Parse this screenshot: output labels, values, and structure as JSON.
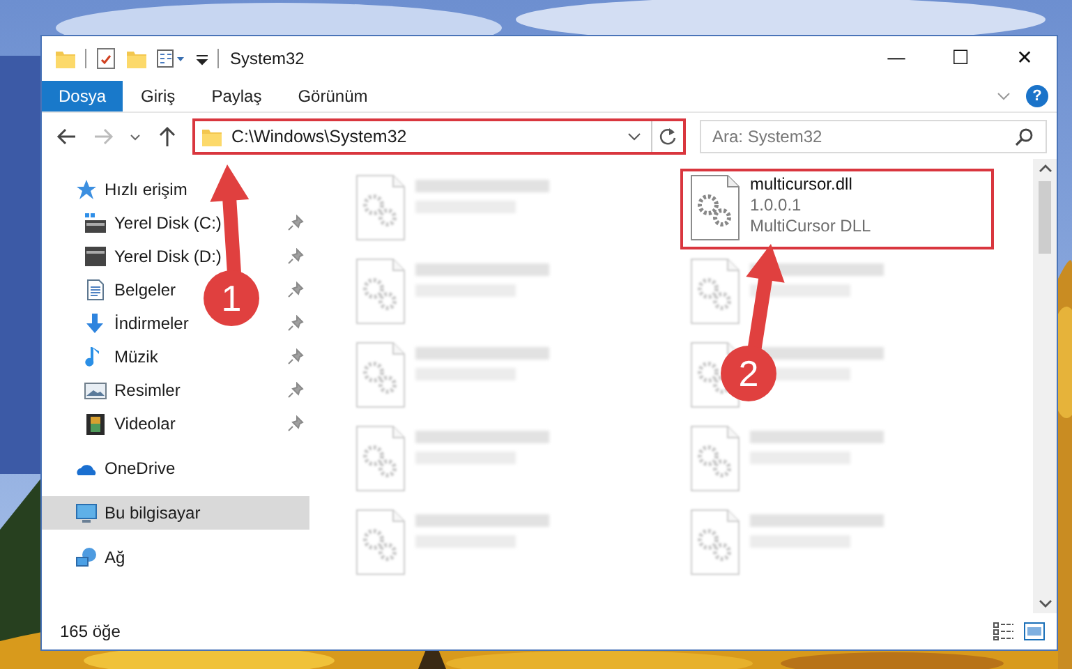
{
  "window": {
    "title": "System32",
    "controls": {
      "minimize": "—",
      "maximize": "☐",
      "close": "✕"
    }
  },
  "ribbon": {
    "tabs": [
      {
        "label": "Dosya",
        "selected": true
      },
      {
        "label": "Giriş",
        "selected": false
      },
      {
        "label": "Paylaş",
        "selected": false
      },
      {
        "label": "Görünüm",
        "selected": false
      }
    ],
    "help": "?"
  },
  "address_bar": {
    "path": "C:\\Windows\\System32",
    "highlighted": true
  },
  "search": {
    "placeholder": "Ara: System32"
  },
  "nav": [
    {
      "label": "Hızlı erişim",
      "selected": false,
      "children": [
        {
          "label": "Yerel Disk (C:)",
          "pinned": true,
          "selected": false
        },
        {
          "label": "Yerel Disk (D:)",
          "pinned": true,
          "selected": false
        },
        {
          "label": "Belgeler",
          "pinned": true,
          "selected": false
        },
        {
          "label": "İndirmeler",
          "pinned": true,
          "selected": false
        },
        {
          "label": "Müzik",
          "pinned": true,
          "selected": false
        },
        {
          "label": "Resimler",
          "pinned": true,
          "selected": false
        },
        {
          "label": "Videolar",
          "pinned": true,
          "selected": false
        }
      ]
    },
    {
      "label": "OneDrive",
      "selected": false
    },
    {
      "label": "Bu bilgisayar",
      "selected": true
    },
    {
      "label": "Ağ",
      "selected": false
    }
  ],
  "files": [
    {
      "kind": "blurred"
    },
    {
      "kind": "file",
      "name": "multicursor.dll",
      "lines": [
        "1.0.0.1",
        "MultiCursor DLL"
      ],
      "highlighted": true
    },
    {
      "kind": "blurred"
    },
    {
      "kind": "blurred"
    },
    {
      "kind": "blurred"
    },
    {
      "kind": "blurred"
    },
    {
      "kind": "blurred"
    },
    {
      "kind": "blurred"
    },
    {
      "kind": "blurred"
    },
    {
      "kind": "blurred"
    }
  ],
  "status_bar": {
    "item_count": "165 öğe"
  },
  "annotations": [
    {
      "kind": "arrow",
      "number": "1"
    },
    {
      "kind": "arrow",
      "number": "2"
    }
  ]
}
